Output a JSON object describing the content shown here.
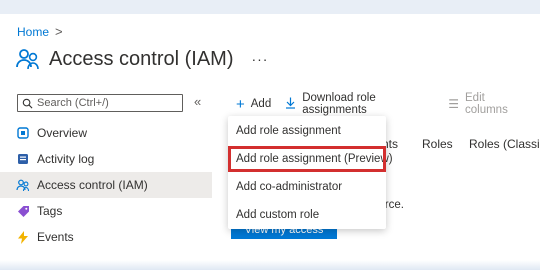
{
  "breadcrumb": {
    "home": "Home",
    "separator": ">"
  },
  "page": {
    "title": "Access control (IAM)",
    "more": "···"
  },
  "search": {
    "placeholder": "Search (Ctrl+/)"
  },
  "sidebar": {
    "collapse": "«",
    "items": [
      {
        "label": "Overview",
        "icon": "overview-icon"
      },
      {
        "label": "Activity log",
        "icon": "activity-log-icon"
      },
      {
        "label": "Access control (IAM)",
        "icon": "people-icon",
        "active": true
      },
      {
        "label": "Tags",
        "icon": "tag-icon"
      },
      {
        "label": "Events",
        "icon": "lightning-icon"
      }
    ]
  },
  "toolbar": {
    "add": "Add",
    "download": "Download role assignments",
    "edit_columns": "Edit columns"
  },
  "tabs": {
    "partial": "nts",
    "roles": "Roles",
    "roles_classic": "Roles (Classic)"
  },
  "content": {
    "text": "ource.",
    "button": "View my access"
  },
  "dropdown": {
    "items": [
      {
        "label": "Add role assignment"
      },
      {
        "label": "Add role assignment (Preview)",
        "highlighted": true
      },
      {
        "label": "Add co-administrator"
      },
      {
        "label": "Add custom role"
      }
    ]
  },
  "colors": {
    "accent": "#0078d4",
    "highlight": "#d32f2f",
    "active_bg": "#edebe9"
  }
}
